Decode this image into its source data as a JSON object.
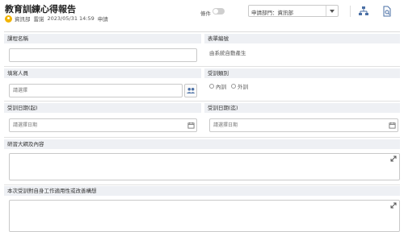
{
  "header": {
    "title": "教育訓練心得報告",
    "dept": "資訊部",
    "user": "雷諾",
    "datetime": "2023/05/31 14:59",
    "status": "申請",
    "condition_label": "條件",
    "dept_select_value": "申請部門：資訊部",
    "icons": [
      "org-chart-icon",
      "document-search-icon"
    ]
  },
  "form": {
    "course_name_label": "課程名稱",
    "form_no_label": "表單編號",
    "form_no_value": "由系統自動產生",
    "filler_label": "填寫人員",
    "filler_placeholder": "請選擇",
    "training_type_label": "受訓類別",
    "training_type_options": [
      "內訓",
      "外訓"
    ],
    "start_date_label": "受訓日期(起)",
    "start_date_placeholder": "請選擇日期",
    "end_date_label": "受訓日期(迄)",
    "end_date_placeholder": "請選擇日期",
    "outline_label": "研習大綱及內容",
    "feedback_label": "本次受訓對自身工作適用性或改善構想"
  },
  "colors": {
    "label_bg": "#eef0f4",
    "border": "#c9c9c9",
    "avatar": "#f2b400",
    "icon_blue": "#4a6fa5"
  }
}
